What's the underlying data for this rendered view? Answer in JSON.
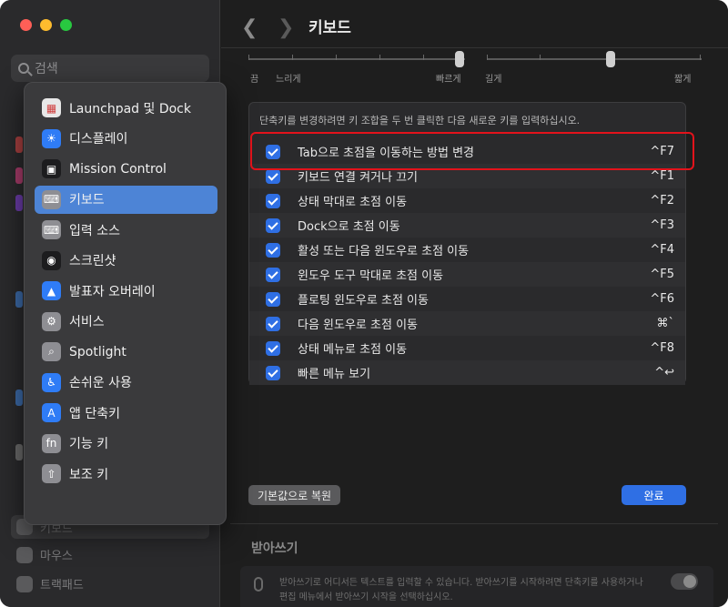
{
  "sidebar": {
    "search_placeholder": "검색",
    "bg_items": [
      "키보드",
      "마우스",
      "트랙패드"
    ]
  },
  "header": {
    "title": "키보드"
  },
  "sliders": {
    "labels": [
      "끔",
      "느리게",
      "빠르게",
      "길게",
      "짧게"
    ]
  },
  "shortcuts": {
    "hint": "단축키를 변경하려면 키 조합을 두 번 클릭한 다음 새로운 키를 입력하십시오.",
    "rows": [
      {
        "label": "Tab으로 초점을 이동하는 방법 변경",
        "key": "^F7"
      },
      {
        "label": "키보드 연결 켜거나 끄기",
        "key": "^F1"
      },
      {
        "label": "상태 막대로 초점 이동",
        "key": "^F2"
      },
      {
        "label": "Dock으로 초점 이동",
        "key": "^F3"
      },
      {
        "label": "활성 또는 다음 윈도우로 초점 이동",
        "key": "^F4"
      },
      {
        "label": "윈도우 도구 막대로 초점 이동",
        "key": "^F5"
      },
      {
        "label": "플로팅 윈도우로 초점 이동",
        "key": "^F6"
      },
      {
        "label": "다음 윈도우로 초점 이동",
        "key": "⌘`"
      },
      {
        "label": "상태 메뉴로 초점 이동",
        "key": "^F8"
      },
      {
        "label": "빠른 메뉴 보기",
        "key": "^↩"
      }
    ]
  },
  "buttons": {
    "restore": "기본값으로 복원",
    "done": "완료"
  },
  "dictation": {
    "title": "받아쓰기",
    "line1": "받아쓰기로 어디서든 텍스트를 입력할 수 있습니다. 받아쓰기를 시작하려면 단축키를 사용하거나",
    "line2": "편집 메뉴에서 받아쓰기 시작을 선택하십시오."
  },
  "menu": {
    "items": [
      {
        "label": "Launchpad 및 Dock",
        "icon": "launchpad-icon",
        "color": "#e8e8e8"
      },
      {
        "label": "디스플레이",
        "icon": "display-icon",
        "color": "#2f7cf6"
      },
      {
        "label": "Mission Control",
        "icon": "mission-control-icon",
        "color": "#1c1c1e"
      },
      {
        "label": "키보드",
        "icon": "keyboard-icon",
        "color": "#8e8e93"
      },
      {
        "label": "입력 소스",
        "icon": "input-source-icon",
        "color": "#8e8e93"
      },
      {
        "label": "스크린샷",
        "icon": "screenshot-icon",
        "color": "#1c1c1e"
      },
      {
        "label": "발표자 오버레이",
        "icon": "presenter-overlay-icon",
        "color": "#2f7cf6"
      },
      {
        "label": "서비스",
        "icon": "services-icon",
        "color": "#8e8e93"
      },
      {
        "label": "Spotlight",
        "icon": "spotlight-icon",
        "color": "#8e8e93"
      },
      {
        "label": "손쉬운 사용",
        "icon": "accessibility-icon",
        "color": "#2f7cf6"
      },
      {
        "label": "앱 단축키",
        "icon": "app-shortcuts-icon",
        "color": "#2f7cf6"
      },
      {
        "label": "기능 키",
        "icon": "fn-key-icon",
        "color": "#8e8e93"
      },
      {
        "label": "보조 키",
        "icon": "modifier-keys-icon",
        "color": "#8e8e93"
      }
    ],
    "selected_index": 3
  }
}
